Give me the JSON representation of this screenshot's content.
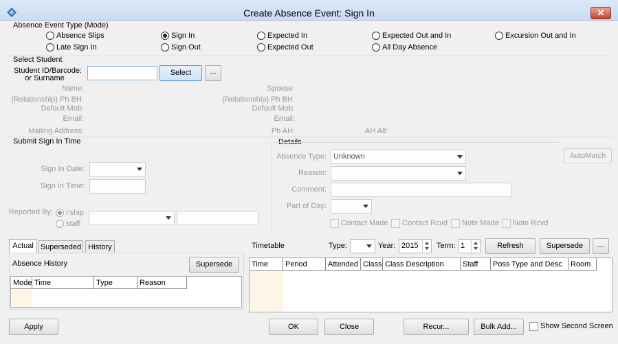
{
  "window": {
    "title": "Create Absence Event: Sign In",
    "close_label": "✕"
  },
  "mode": {
    "title": "Absence Event Type (Mode)",
    "options": [
      {
        "label": "Absence Slips",
        "checked": false
      },
      {
        "label": "Sign In",
        "checked": true
      },
      {
        "label": "Expected In",
        "checked": false
      },
      {
        "label": "Expected Out and In",
        "checked": false
      },
      {
        "label": "Excursion Out and In",
        "checked": false
      },
      {
        "label": "Late Sign In",
        "checked": false
      },
      {
        "label": "Sign Out",
        "checked": false
      },
      {
        "label": "Expected Out",
        "checked": false
      },
      {
        "label": "All Day Absence",
        "checked": false
      }
    ]
  },
  "student": {
    "title": "Select Student",
    "id_label_line1": "Student ID/Barcode:",
    "id_label_line2": "or Surname",
    "id_value": "",
    "select_label": "Select",
    "more_label": "...",
    "name_label": "Name:",
    "ph_bh_rel_label": "(Relationship) Ph BH:",
    "default_mob_label": "Default Mob:",
    "email_label": "Email:",
    "mailing_label": "Mailing Address:",
    "spouse_label": "Spouse:",
    "spouse_ph_bh_label": "(Relationship) Ph BH:",
    "spouse_default_mob_label": "Default Mob:",
    "spouse_email_label": "Email:",
    "ph_ah_label": "Ph AH:",
    "ah_alt_label": "AH Alt:"
  },
  "submit": {
    "title": "Submit Sign In Time",
    "date_label": "Sign In Date:",
    "date_value": "",
    "time_label": "Sign In Time:",
    "time_value": "",
    "reported_label": "Reported By:",
    "rship_label": "r'ship",
    "staff_label": "staff",
    "reported_select_value": "",
    "reported_text_value": ""
  },
  "details": {
    "title": "Details",
    "type_label": "Absence Type:",
    "type_value": "Unknown",
    "reason_label": "Reason:",
    "reason_value": "",
    "comment_label": "Comment:",
    "comment_value": "",
    "part_label": "Part of Day:",
    "part_value": "",
    "automatch_label": "AutoMatch",
    "checks": [
      "Contact Made",
      "Contact Rcvd",
      "Note Made",
      "Note Rcvd"
    ]
  },
  "history": {
    "tabs": [
      "Actual",
      "Superseded",
      "History"
    ],
    "active_tab": "Actual",
    "title": "Absence History",
    "supersede_label": "Supersede",
    "columns": [
      "Mode",
      "Time",
      "Type",
      "Reason"
    ]
  },
  "timetable": {
    "title": "Timetable",
    "type_label": "Type:",
    "type_value": "",
    "year_label": "Year:",
    "year_value": "2015",
    "term_label": "Term:",
    "term_value": "1",
    "refresh_label": "Refresh",
    "supersede_label": "Supersede",
    "more_label": "...",
    "columns": [
      "Time",
      "Period",
      "Attended",
      "Class",
      "Class Description",
      "Staff",
      "Poss Type and Desc",
      "Room"
    ]
  },
  "footer": {
    "apply_label": "Apply",
    "ok_label": "OK",
    "close_label": "Close",
    "recur_label": "Recur...",
    "bulk_add_label": "Bulk Add...",
    "show_second_label": "Show Second Screen",
    "show_second_checked": false
  },
  "colors": {
    "title_bar": "#c9dcf2",
    "close_button": "#c7432c",
    "select_focus": "#5c9ad8"
  }
}
